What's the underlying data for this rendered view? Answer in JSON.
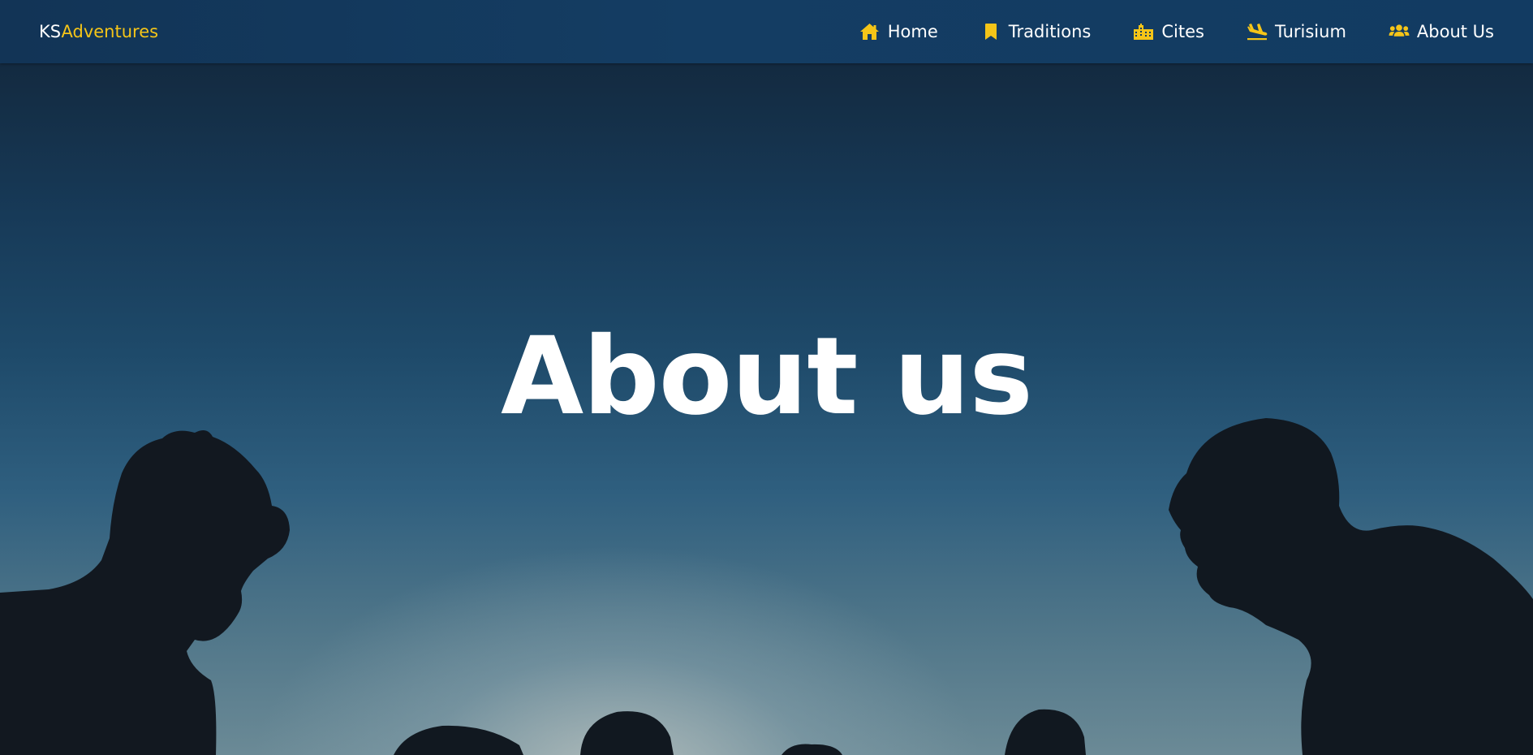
{
  "navbar": {
    "brand_a": "KS",
    "brand_b": "Adventures",
    "accent_color": "#f5c518",
    "items": [
      {
        "label": "Home",
        "icon": "home-icon"
      },
      {
        "label": "Traditions",
        "icon": "bookmark-icon"
      },
      {
        "label": "Cites",
        "icon": "city-icon"
      },
      {
        "label": "Turisium",
        "icon": "plane-arrival-icon"
      },
      {
        "label": "About Us",
        "icon": "users-icon"
      }
    ]
  },
  "hero": {
    "title": "About us"
  }
}
